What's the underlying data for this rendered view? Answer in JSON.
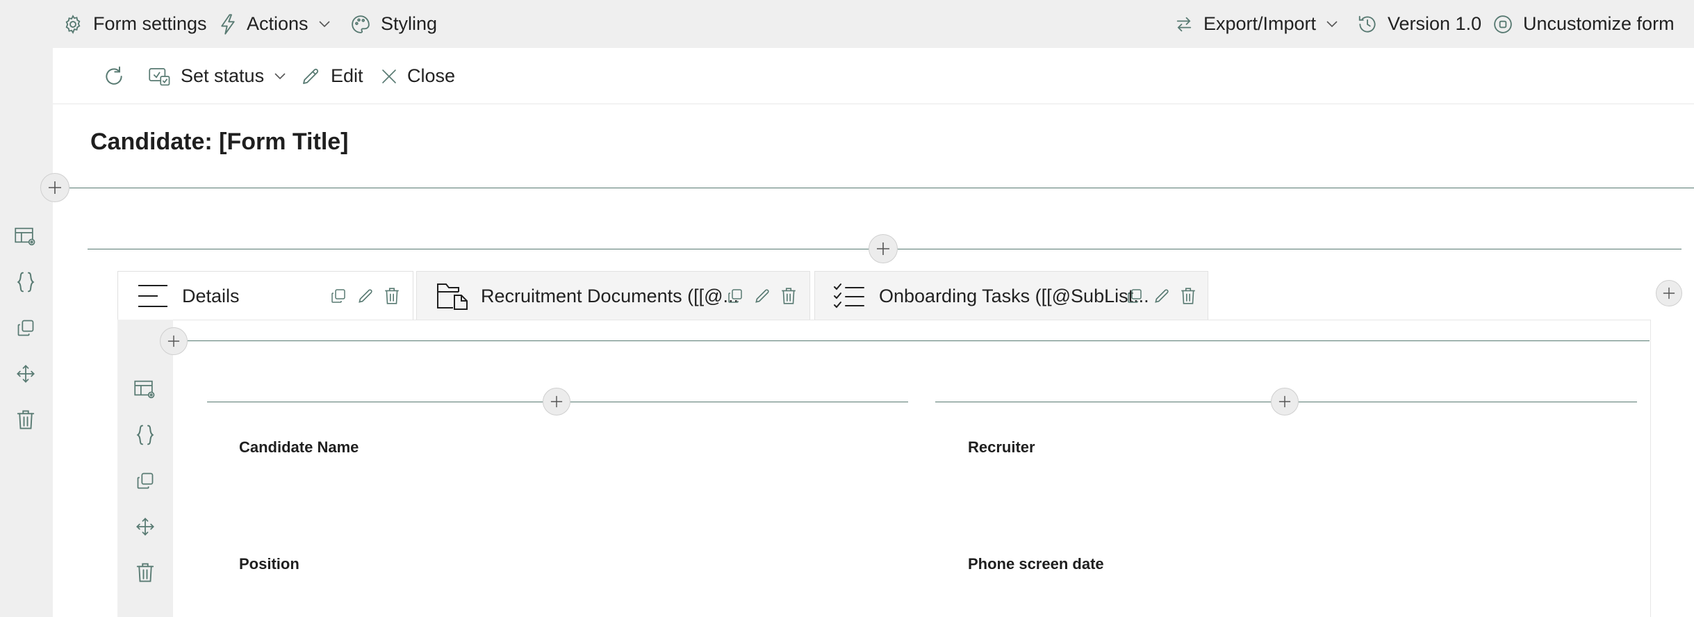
{
  "topbar": {
    "form_settings": "Form settings",
    "actions": "Actions",
    "styling": "Styling",
    "export_import": "Export/Import",
    "version": "Version 1.0",
    "uncustomize": "Uncustomize form"
  },
  "commandbar": {
    "set_status": "Set status",
    "edit": "Edit",
    "close": "Close"
  },
  "form": {
    "title": "Candidate: [Form Title]"
  },
  "tabs": [
    {
      "label": "Details",
      "icon": "lines-icon"
    },
    {
      "label": "Recruitment Documents ([[@...",
      "icon": "folder-document-icon"
    },
    {
      "label": "Onboarding Tasks ([[@SubList...",
      "icon": "checklist-icon"
    }
  ],
  "fields": {
    "candidate_name": "Candidate Name",
    "recruiter": "Recruiter",
    "position": "Position",
    "phone_screen_date": "Phone screen date"
  },
  "colors": {
    "icon": "#587a72",
    "divider": "#587a72",
    "background": "#efefef"
  }
}
